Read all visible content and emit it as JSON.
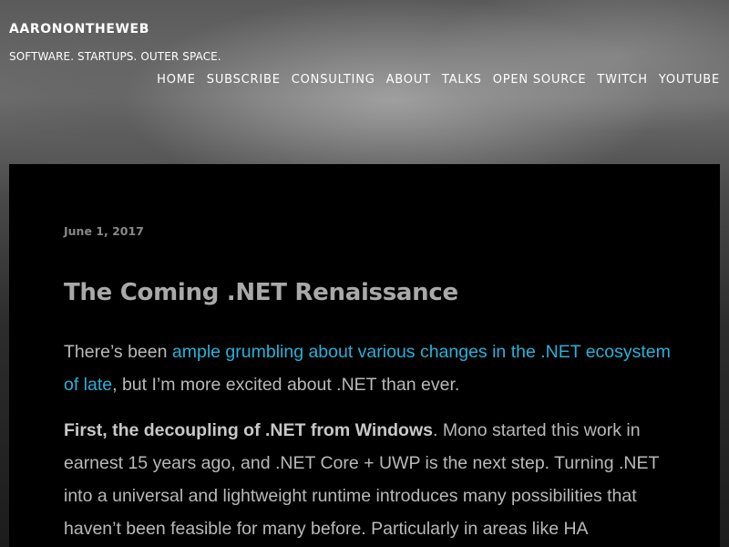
{
  "site": {
    "title": "AARONONTHEWEB",
    "tagline": "SOFTWARE. STARTUPS. OUTER SPACE."
  },
  "nav": {
    "items": [
      {
        "label": "HOME"
      },
      {
        "label": "SUBSCRIBE"
      },
      {
        "label": "CONSULTING"
      },
      {
        "label": "ABOUT"
      },
      {
        "label": "TALKS"
      },
      {
        "label": "OPEN SOURCE"
      },
      {
        "label": "TWITCH"
      },
      {
        "label": "YOUTUBE"
      }
    ]
  },
  "post": {
    "date": "June 1, 2017",
    "title": "The Coming .NET Renaissance",
    "p1": {
      "before": "There’s been ",
      "link": "ample grumbling about various changes in the .NET ecosystem of late",
      "after": ", but I’m more excited about .NET than ever."
    },
    "p2": {
      "strong": "First, the decoupling of .NET from Windows",
      "rest": ". Mono started this work in earnest 15 years ago, and .NET Core + UWP is the next step. Turning .NET into a universal and lightweight runtime introduces many possibilities that haven’t been feasible for many before. Particularly in areas like HA"
    }
  },
  "colors": {
    "link": "#2ab0d8",
    "article_bg": "#000000",
    "title_text": "#a9a9a9",
    "body_text": "#b9b9b9"
  }
}
